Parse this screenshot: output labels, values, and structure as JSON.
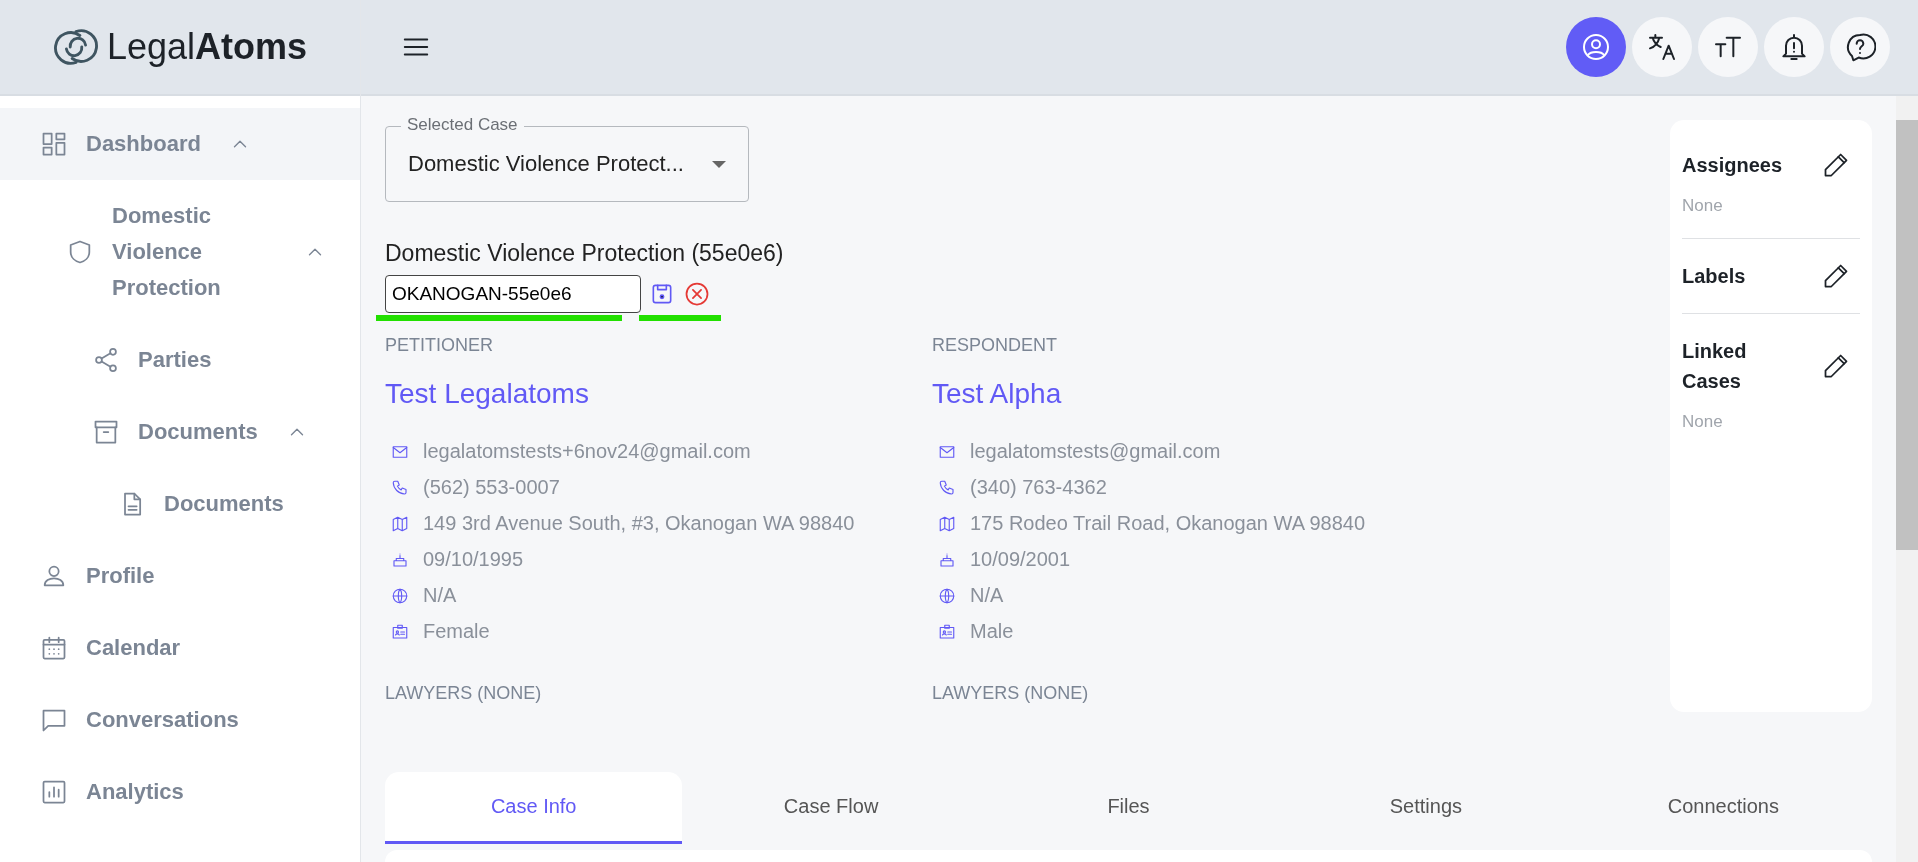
{
  "logo": {
    "text_light": "Legal",
    "text_bold": "Atoms"
  },
  "sidebar": {
    "items": [
      {
        "label": "Dashboard",
        "selected": true,
        "expanded": true,
        "children": [
          {
            "label": "Domestic Violence Protection",
            "selected": false,
            "expanded": true,
            "children": [
              {
                "label": "Parties",
                "selected": false
              },
              {
                "label": "Documents",
                "selected": false,
                "expanded": true,
                "children": [
                  {
                    "label": "Documents",
                    "selected": false
                  }
                ]
              }
            ]
          }
        ]
      },
      {
        "label": "Profile",
        "selected": false
      },
      {
        "label": "Calendar",
        "selected": false
      },
      {
        "label": "Conversations",
        "selected": false
      },
      {
        "label": "Analytics",
        "selected": false
      }
    ]
  },
  "selected_case": {
    "label": "Selected Case",
    "value": "Domestic Violence Protect..."
  },
  "case": {
    "title": "Domestic Violence Protection (55e0e6)",
    "name_value": "OKANOGAN-55e0e6"
  },
  "parties": [
    {
      "role": "PETITIONER",
      "name": "Test Legalatoms",
      "details": [
        "legalatomstests+6nov24@gmail.com",
        "(562) 553-0007",
        "149 3rd Avenue South, #3, Okanogan WA 98840",
        "09/10/1995",
        "N/A",
        "Female"
      ],
      "lawyers": "LAWYERS (NONE)"
    },
    {
      "role": "RESPONDENT",
      "name": "Test Alpha",
      "details": [
        "legalatomstests@gmail.com",
        "(340) 763-4362",
        "175 Rodeo Trail Road, Okanogan WA 98840",
        "10/09/2001",
        "N/A",
        "Male"
      ],
      "lawyers": "LAWYERS (NONE)"
    }
  ],
  "side_panel": [
    {
      "title": "Assignees",
      "value": "None"
    },
    {
      "title": "Labels"
    },
    {
      "title": "Linked Cases",
      "value": "None"
    }
  ],
  "tabs": [
    {
      "label": "Case Info",
      "selected": true
    },
    {
      "label": "Case Flow",
      "selected": false
    },
    {
      "label": "Files",
      "selected": false
    },
    {
      "label": "Settings",
      "selected": false
    },
    {
      "label": "Connections",
      "selected": false
    }
  ]
}
